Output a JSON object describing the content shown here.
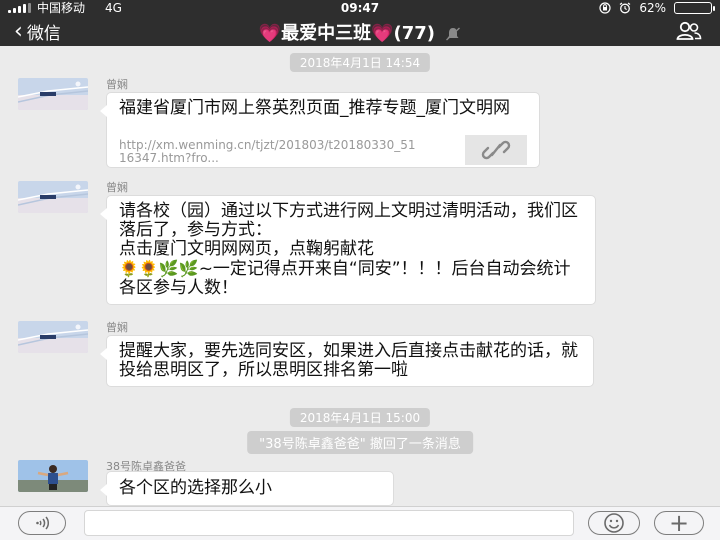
{
  "status_bar": {
    "carrier": "中国移动",
    "network": "4G",
    "time": "09:47",
    "battery": "62%",
    "battery_level": 0.62
  },
  "nav": {
    "back_label": "微信",
    "heart": "💗",
    "group_name": "最爱中三班",
    "member_count": "(77)"
  },
  "messages": {
    "ts1": "2018年4月1日 14:54",
    "m1": {
      "sender": "曾娴",
      "link_title": "福建省厦门市网上祭英烈页面_推荐专题_厦门文明网",
      "link_url": "http://xm.wenming.cn/tjzt/201803/t20180330_5116347.htm?fro..."
    },
    "m2": {
      "sender": "曾娴",
      "line1": "请各校（园）通过以下方式进行网上文明过清明活动，我们区落后了，参与方式：",
      "line2": "点击厦门文明网网页，点鞠躬献花",
      "emojis": "🌻🌻🌿🌿",
      "line3": "~一定记得点开来自“同安”！！！后台自动会统计各区参与人数！"
    },
    "m3": {
      "sender": "曾娴",
      "text": "提醒大家，要先选同安区，如果进入后直接点击献花的话，就投给思明区了，所以思明区排名第一啦"
    },
    "ts2": "2018年4月1日 15:00",
    "recall_notice": "\"38号陈卓鑫爸爸\" 撤回了一条消息",
    "m4": {
      "sender": "38号陈卓鑫爸爸",
      "text": "各个区的选择那么小"
    }
  },
  "input_bar": {
    "plus_label": "+"
  }
}
